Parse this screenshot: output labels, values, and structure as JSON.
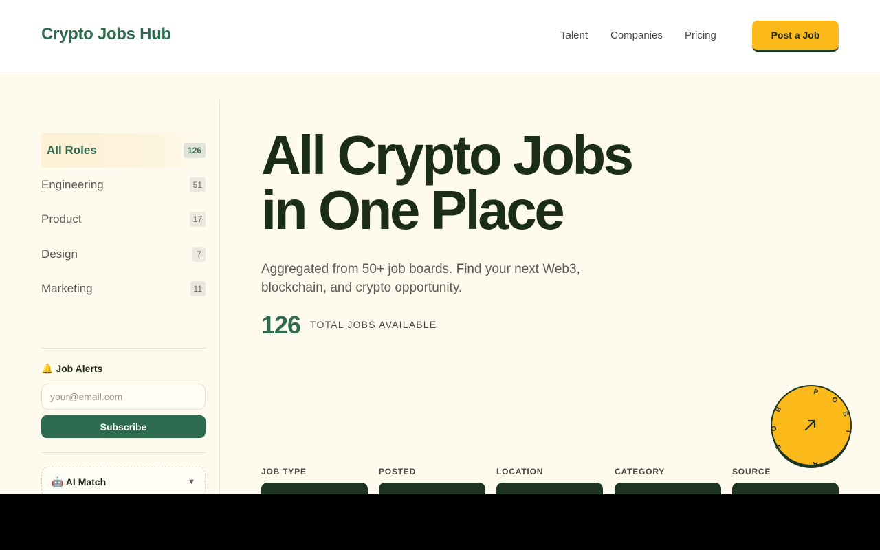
{
  "header": {
    "logo": "Crypto Jobs Hub",
    "nav": [
      "Talent",
      "Companies",
      "Pricing"
    ],
    "cta": "Post a Job"
  },
  "sidebar": {
    "categories": [
      {
        "label": "All Roles",
        "count": "126"
      },
      {
        "label": "Engineering",
        "count": "51"
      },
      {
        "label": "Product",
        "count": "17"
      },
      {
        "label": "Design",
        "count": "7"
      },
      {
        "label": "Marketing",
        "count": "11"
      }
    ],
    "alerts": {
      "title": "🔔 Job Alerts",
      "placeholder": "your@email.com",
      "button": "Subscribe"
    },
    "ai_match": {
      "label": "🤖 AI Match",
      "icon": "chevron-down-icon"
    }
  },
  "hero": {
    "title_line1": "All Crypto Jobs",
    "title_line2": "in One Place",
    "subtitle": "Aggregated from 50+ job boards. Find your next Web3, blockchain, and crypto opportunity.",
    "total_jobs": "126",
    "total_label": "TOTAL JOBS AVAILABLE"
  },
  "filters": [
    "JOB TYPE",
    "POSTED",
    "LOCATION",
    "CATEGORY",
    "SOURCE"
  ],
  "badge": {
    "letters": [
      "P",
      "O",
      "S",
      "T",
      "A",
      "J",
      "O",
      "B"
    ],
    "icon": "arrow-up-right-icon"
  },
  "colors": {
    "accent": "#2d6a4f",
    "brand_yellow": "#fbb91a",
    "background": "#fefbee",
    "dark": "#1b2d19"
  }
}
